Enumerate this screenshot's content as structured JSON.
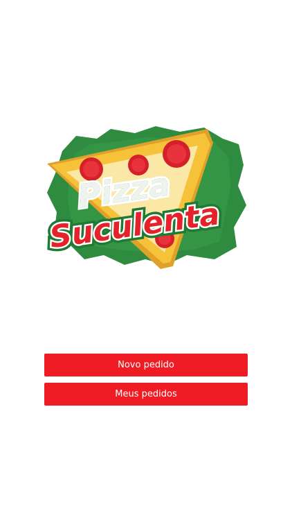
{
  "brand": {
    "word_top": "Pizza",
    "word_bottom": "Suculenta"
  },
  "actions": {
    "new_order_label": "Novo pedido",
    "my_orders_label": "Meus pedidos"
  },
  "colors": {
    "accent_red": "#f01c24",
    "leaf_green": "#2e8b3f",
    "crust_yellow": "#f6c23a"
  }
}
